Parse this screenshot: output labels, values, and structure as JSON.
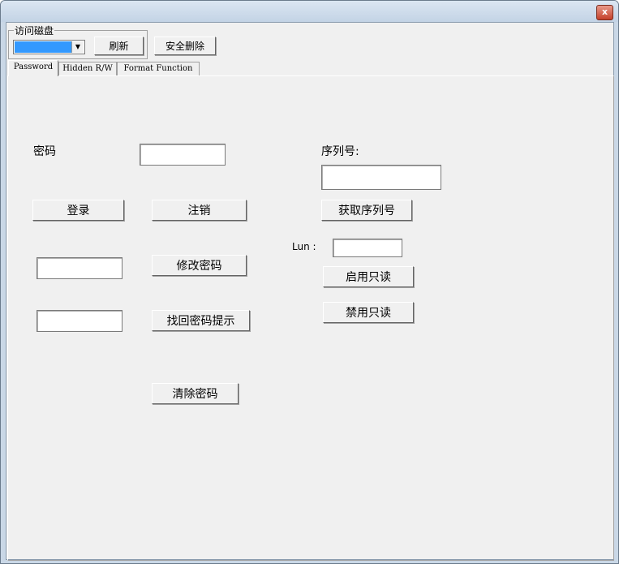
{
  "window": {
    "close_glyph": "x"
  },
  "toolbar": {
    "group_label": "访问磁盘",
    "drive_value": "",
    "refresh_label": "刷新",
    "secure_delete_label": "安全删除"
  },
  "tabs": [
    {
      "label": "Password",
      "active": true
    },
    {
      "label": "Hidden R/W",
      "active": false
    },
    {
      "label": "Format Function",
      "active": false
    }
  ],
  "password": {
    "password_label": "密码",
    "password_value": "",
    "login_label": "登录",
    "logout_label": "注销",
    "new_password_value": "",
    "change_password_label": "修改密码",
    "hint_value": "",
    "recover_hint_label": "找回密码提示",
    "clear_password_label": "清除密码"
  },
  "serial": {
    "serial_label": "序列号:",
    "serial_value": "",
    "get_serial_label": "获取序列号",
    "lun_label": "Lun :",
    "lun_value": "",
    "enable_readonly_label": "启用只读",
    "disable_readonly_label": "禁用只读"
  },
  "colors": {
    "selection": "#3399ff",
    "face": "#f0f0f0",
    "close": "#c4402a"
  }
}
